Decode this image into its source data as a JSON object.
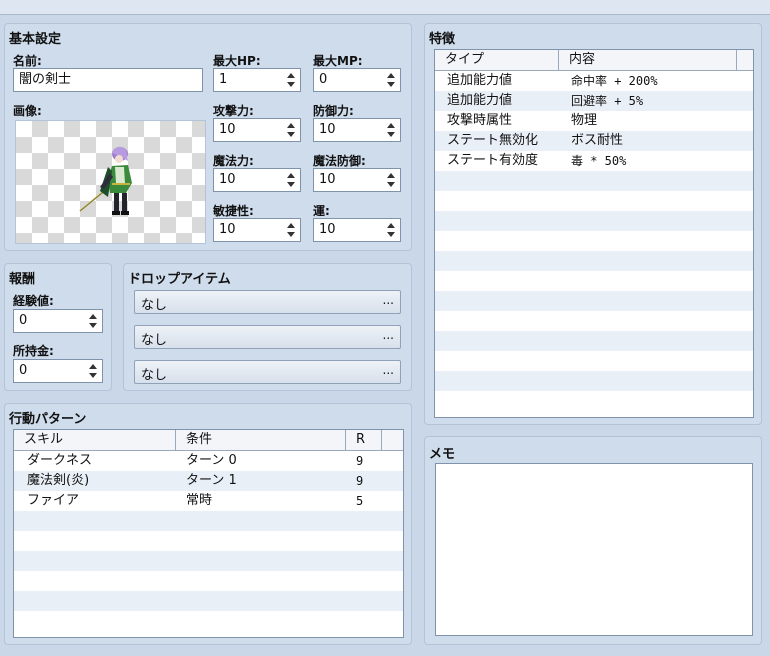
{
  "basic": {
    "title": "基本設定",
    "name_label": "名前:",
    "name_value": "闇の剣士",
    "image_label": "画像:",
    "stats": [
      {
        "label": "最大HP:",
        "value": "1"
      },
      {
        "label": "最大MP:",
        "value": "0"
      },
      {
        "label": "攻撃力:",
        "value": "10"
      },
      {
        "label": "防御力:",
        "value": "10"
      },
      {
        "label": "魔法力:",
        "value": "10"
      },
      {
        "label": "魔法防御:",
        "value": "10"
      },
      {
        "label": "敏捷性:",
        "value": "10"
      },
      {
        "label": "運:",
        "value": "10"
      }
    ]
  },
  "rewards": {
    "title": "報酬",
    "exp_label": "経験値:",
    "exp_value": "0",
    "gold_label": "所持金:",
    "gold_value": "0"
  },
  "drops": {
    "title": "ドロップアイテム",
    "items": [
      {
        "label": "なし",
        "dots": "..."
      },
      {
        "label": "なし",
        "dots": "..."
      },
      {
        "label": "なし",
        "dots": "..."
      }
    ]
  },
  "actions": {
    "title": "行動パターン",
    "headers": [
      "スキル",
      "条件",
      "R"
    ],
    "rows": [
      {
        "skill": "ダークネス",
        "condition": "ターン 0",
        "r": "9"
      },
      {
        "skill": "魔法剣(炎)",
        "condition": "ターン 1",
        "r": "9"
      },
      {
        "skill": "ファイア",
        "condition": "常時",
        "r": "5"
      }
    ]
  },
  "traits": {
    "title": "特徴",
    "headers": [
      "タイプ",
      "内容"
    ],
    "rows": [
      {
        "type": "追加能力値",
        "content": "命中率 + 200%"
      },
      {
        "type": "追加能力値",
        "content": "回避率 + 5%"
      },
      {
        "type": "攻撃時属性",
        "content": "物理"
      },
      {
        "type": "ステート無効化",
        "content": "ボス耐性"
      },
      {
        "type": "ステート有効度",
        "content": "毒 * 50%"
      }
    ]
  },
  "memo": {
    "title": "メモ",
    "value": ""
  }
}
